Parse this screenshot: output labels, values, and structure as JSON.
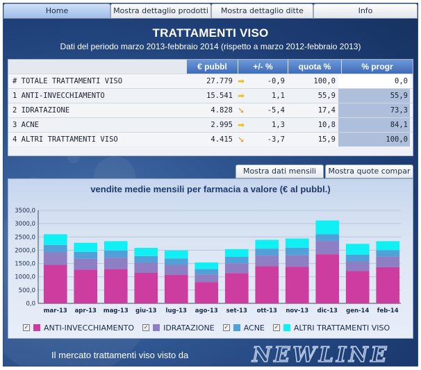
{
  "nav": {
    "tabs": [
      {
        "label": "Home",
        "active": true
      },
      {
        "label": "Mostra dettaglio prodotti",
        "active": false
      },
      {
        "label": "Mostra dettaglio ditte",
        "active": false
      },
      {
        "label": "Info",
        "active": false
      }
    ]
  },
  "header": {
    "title": "TRATTAMENTI VISO",
    "subtitle": "Dati del periodo marzo 2013-febbraio 2014 (rispetto a marzo 2012-febbraio 2013)"
  },
  "table": {
    "columns": {
      "pubbl": "€ pubbl",
      "var": "+/- %",
      "quota": "quota %",
      "progr": "% progr"
    },
    "rows": [
      {
        "name": "# TOTALE TRATTAMENTI VISO",
        "pubbl": "27.779",
        "trend": "right",
        "var": "-0,9",
        "quota": "100,0",
        "progr": "0,0"
      },
      {
        "name": "1 ANTI-INVECCHIAMENTO",
        "pubbl": "15.541",
        "trend": "right",
        "var": "1,1",
        "quota": "55,9",
        "progr": "55,9"
      },
      {
        "name": "2 IDRATAZIONE",
        "pubbl": "4.828",
        "trend": "down",
        "var": "-5,4",
        "quota": "17,4",
        "progr": "73,3"
      },
      {
        "name": "3 ACNE",
        "pubbl": "2.995",
        "trend": "right",
        "var": "1,3",
        "quota": "10,8",
        "progr": "84,1"
      },
      {
        "name": "4 ALTRI TRATTAMENTI VISO",
        "pubbl": "4.415",
        "trend": "down",
        "var": "-3,7",
        "quota": "15,9",
        "progr": "100,0"
      }
    ]
  },
  "subtabs": {
    "monthly": "Mostra dati mensili",
    "shares": "Mostra quote compar"
  },
  "chart_data": {
    "type": "bar",
    "stacked": true,
    "title": "vendite medie mensili per farmacia a valore (€ al pubbl.)",
    "categories": [
      "mar-13",
      "apr-13",
      "mag-13",
      "giu-13",
      "lug-13",
      "ago-13",
      "set-13",
      "ott-13",
      "nov-13",
      "dic-13",
      "gen-14",
      "feb-14"
    ],
    "ylim": [
      0,
      3500
    ],
    "yticks": [
      "0,0",
      "500,0",
      "1000,0",
      "1500,0",
      "2000,0",
      "2500,0",
      "3000,0",
      "3500,0"
    ],
    "series": [
      {
        "name": "ANTI-INVECCHIAMENTO",
        "color": "#cc3d9f",
        "values": [
          1450,
          1270,
          1290,
          1150,
          1070,
          800,
          1140,
          1400,
          1380,
          1850,
          1220,
          1360
        ]
      },
      {
        "name": "IDRATAZIONE",
        "color": "#8e7fc4",
        "values": [
          470,
          410,
          430,
          390,
          380,
          290,
          370,
          400,
          430,
          500,
          360,
          400
        ]
      },
      {
        "name": "ACNE",
        "color": "#52a0d8",
        "values": [
          280,
          260,
          270,
          240,
          240,
          200,
          240,
          260,
          280,
          250,
          250,
          240
        ]
      },
      {
        "name": "ALTRI TRATTAMENTI VISO",
        "color": "#10f0f4",
        "values": [
          400,
          340,
          350,
          310,
          300,
          250,
          290,
          330,
          350,
          520,
          410,
          340
        ]
      }
    ],
    "legend_position": "bottom"
  },
  "footer": {
    "text": "Il mercato trattamenti viso visto da",
    "brand": "NEWLINE"
  },
  "icons": {
    "right": "arrow-right-icon",
    "down": "arrow-down-icon",
    "checkbox": "checkbox-icon"
  }
}
